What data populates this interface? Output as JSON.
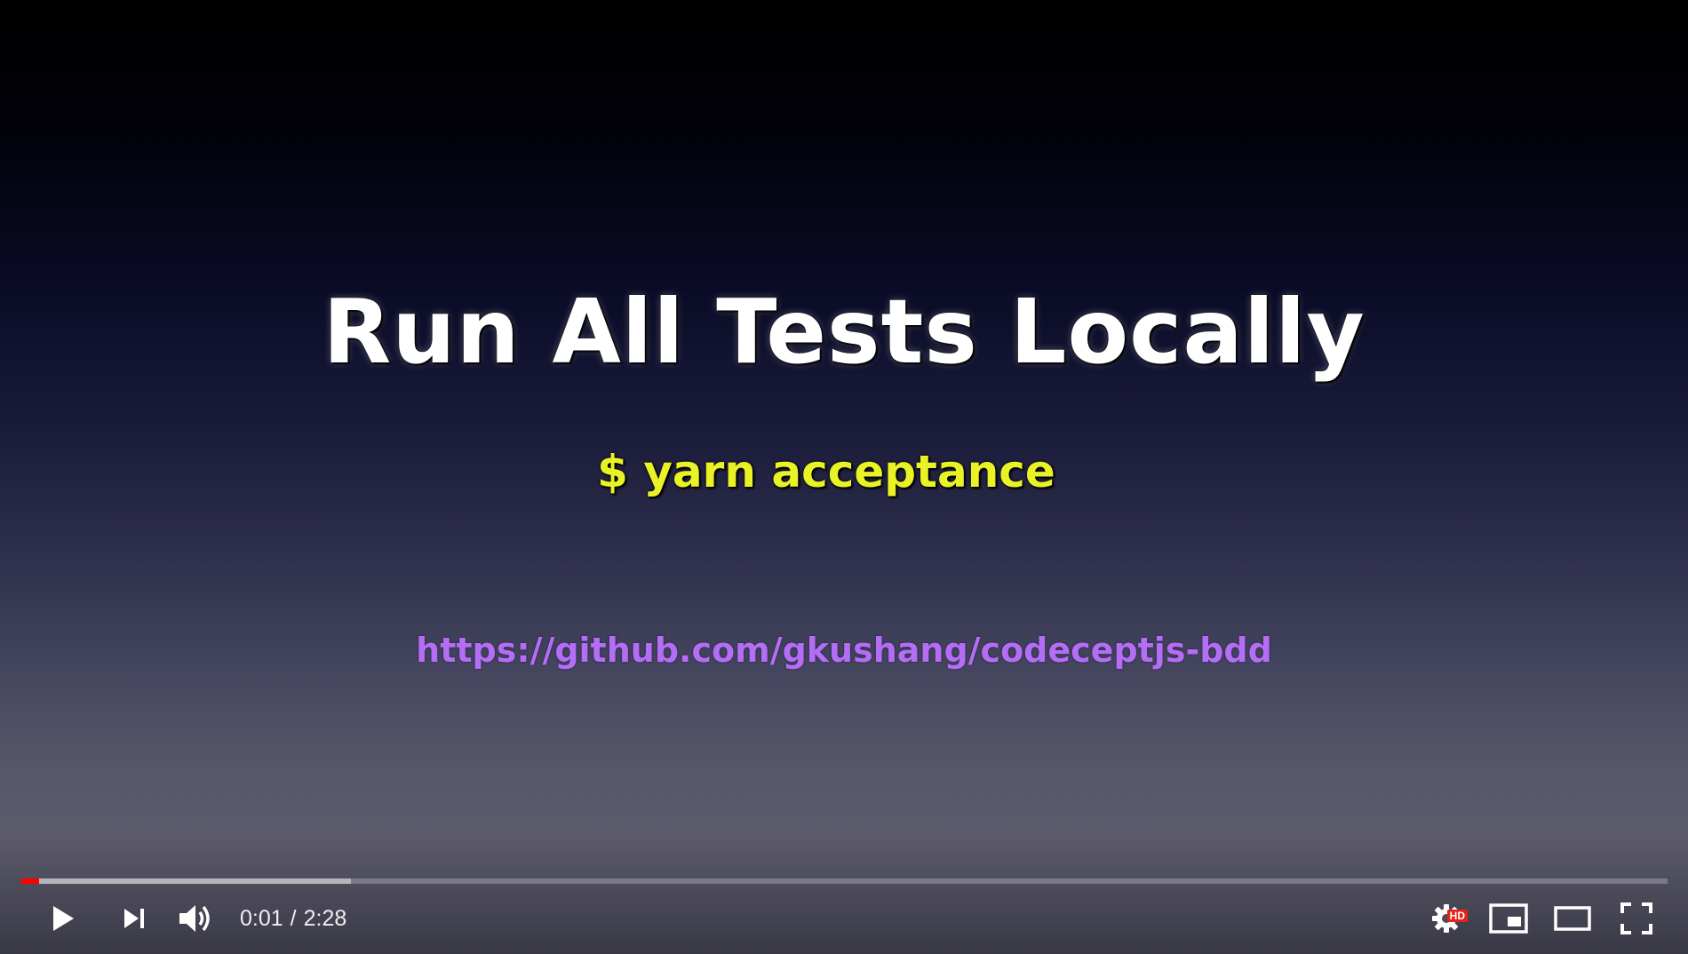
{
  "slide": {
    "title": "Run All Tests Locally",
    "command": "$ yarn acceptance",
    "link": "https://github.com/gkushang/codeceptjs-bdd"
  },
  "player": {
    "current_time": "0:01",
    "separator": "/",
    "duration": "2:28",
    "played_fraction": 0.011,
    "buffered_fraction": 0.2,
    "settings_badge": "HD",
    "colors": {
      "progress_played": "#ff0000",
      "hd_badge": "#e62117",
      "title_text": "#ffffff",
      "command_text": "#e9f225",
      "link_text": "#b46ef5"
    },
    "icons": {
      "play": "play-icon",
      "next": "next-icon",
      "volume": "volume-icon",
      "settings": "gear-icon",
      "miniplayer": "miniplayer-icon",
      "theater": "theater-icon",
      "fullscreen": "fullscreen-icon"
    }
  }
}
